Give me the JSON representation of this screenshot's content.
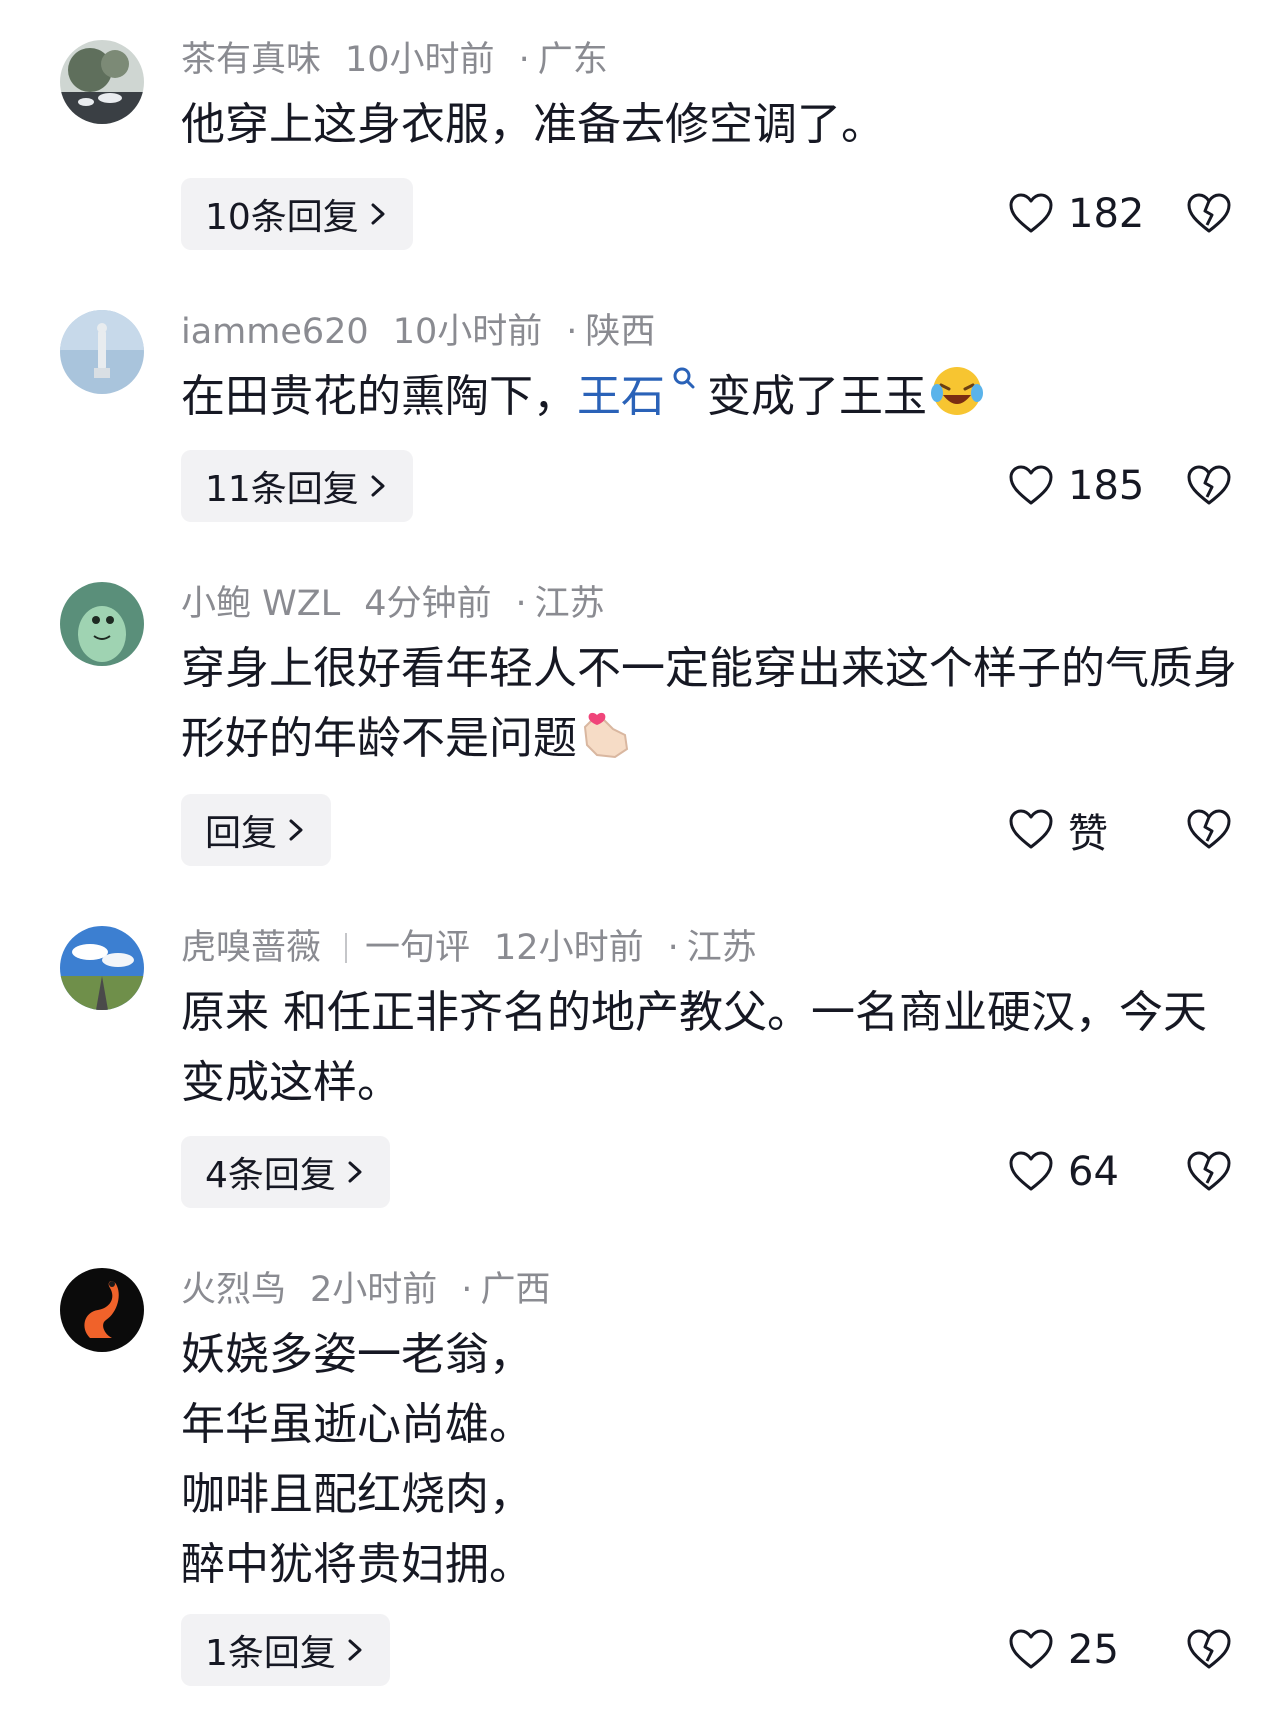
{
  "comments": [
    {
      "username": "茶有真味",
      "time": "10小时前",
      "region": "广东",
      "text": "他穿上这身衣服，准备去修空调了。",
      "reply_label": "10条回复",
      "likes": "182"
    },
    {
      "username": "iamme620",
      "time": "10小时前",
      "region": "陕西",
      "text_before": "在田贵花的熏陶下，",
      "link_text": "王石",
      "text_after": "变成了王玉",
      "reply_label": "11条回复",
      "likes": "185"
    },
    {
      "username": "小鲍 WZL",
      "time": "4分钟前",
      "region": "江苏",
      "text": "穿身上很好看年轻人不一定能穿出来这个样子的气质身形好的年龄不是问题",
      "reply_label": "回复",
      "likes": "赞"
    },
    {
      "username": "虎嗅蔷薇",
      "tag": "一句评",
      "time": "12小时前",
      "region": "江苏",
      "text": "原来 和任正非齐名的地产教父。一名商业硬汉，今天变成这样。",
      "reply_label": "4条回复",
      "likes": "64"
    },
    {
      "username": "火烈鸟",
      "time": "2小时前",
      "region": "广西",
      "lines": [
        "妖娆多姿一老翁，",
        "年华虽逝心尚雄。",
        "咖啡且配红烧肉，",
        "醉中犹将贵妇拥。"
      ],
      "reply_label": "1条回复",
      "likes": "25"
    }
  ],
  "meta_separator": "·",
  "colors": {
    "meta": "#8a8b91",
    "text": "#161823",
    "link": "#2a62b8",
    "reply_bg": "#f2f2f4"
  }
}
